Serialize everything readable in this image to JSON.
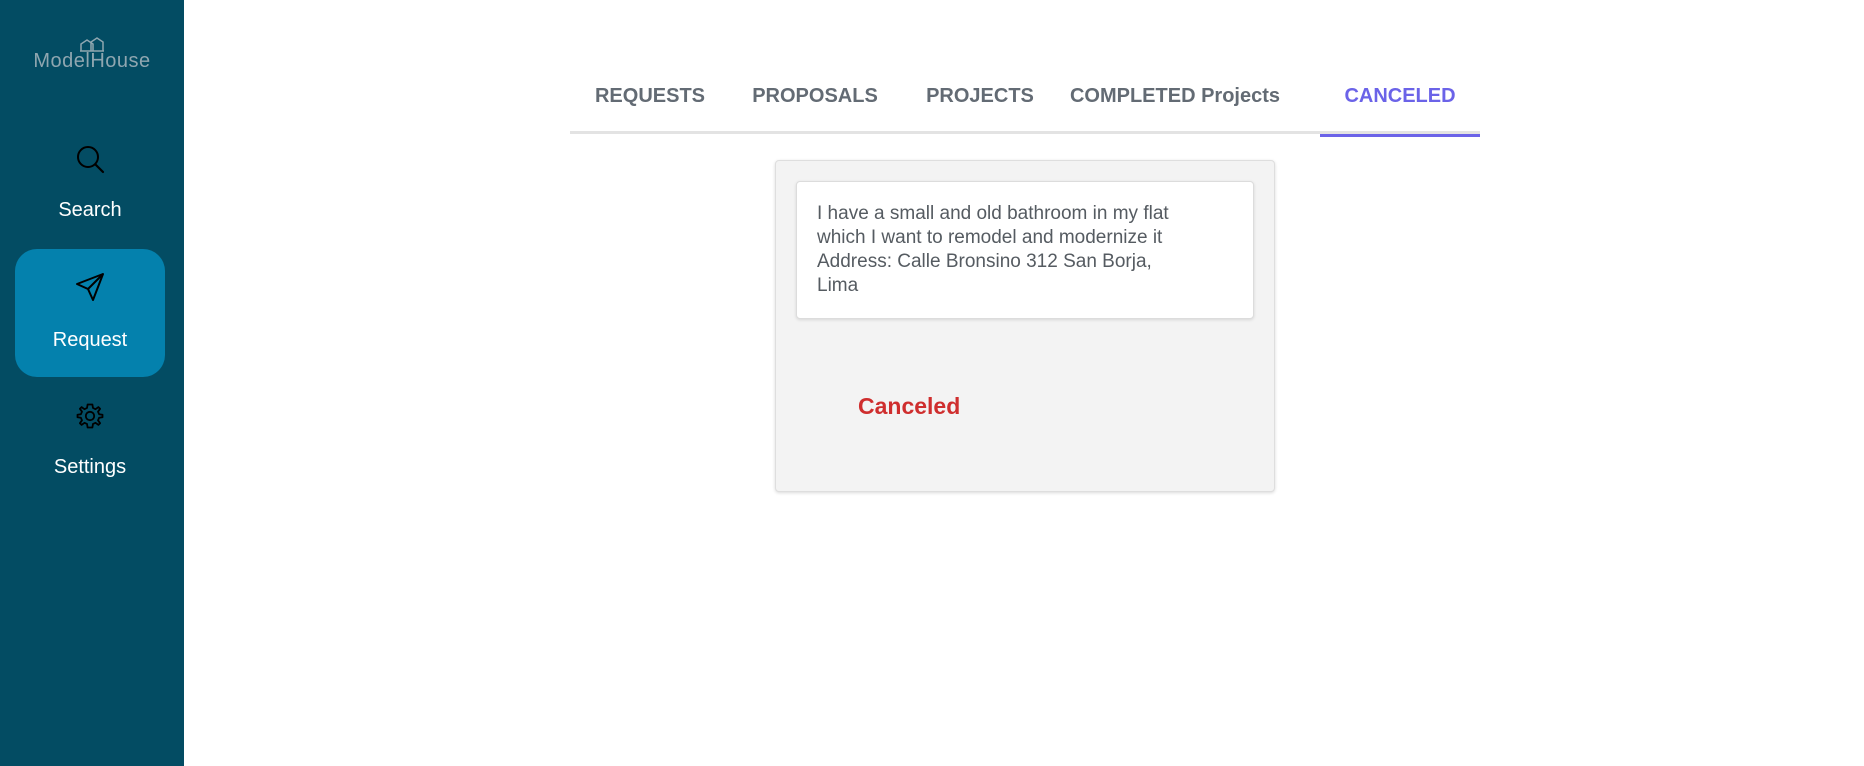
{
  "sidebar": {
    "logo": "ModelHouse",
    "items": [
      {
        "label": "Search",
        "icon": "search-icon"
      },
      {
        "label": "Request",
        "icon": "send-icon"
      },
      {
        "label": "Settings",
        "icon": "gear-icon"
      }
    ],
    "active_index": 1
  },
  "tabs": [
    {
      "label": "REQUESTS"
    },
    {
      "label": "PROPOSALS"
    },
    {
      "label": "PROJECTS"
    },
    {
      "label": "COMPLETED Projects"
    },
    {
      "label": "CANCELED"
    }
  ],
  "active_tab": "CANCELED",
  "card": {
    "description_lines": [
      "I have a small and old bathroom in my flat",
      "which I want to remodel and modernize it",
      "Address: Calle Bronsino 312 San Borja,",
      "Lima"
    ],
    "status": "Canceled"
  },
  "colors": {
    "sidebar_bg": "#034c63",
    "active_nav_bg": "#0481ad",
    "active_tab": "#6b63e8",
    "status_canceled": "#cf2e2e"
  }
}
